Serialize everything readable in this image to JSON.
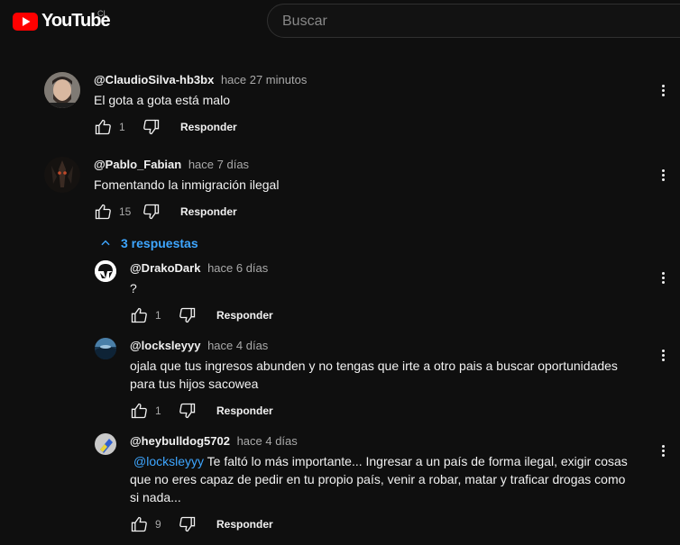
{
  "header": {
    "logo_text": "YouTube",
    "country_code": "CL",
    "search_placeholder": "Buscar"
  },
  "colors": {
    "background": "#0f0f0f",
    "text": "#f1f1f1",
    "secondary": "#aaaaaa",
    "link": "#3ea6ff",
    "brand_red": "#ff0000"
  },
  "comments": [
    {
      "author": "@ClaudioSilva-hb3bx",
      "time": "hace 27 minutos",
      "text": "El gota a gota está malo",
      "likes": "1",
      "reply_label": "Responder"
    },
    {
      "author": "@Pablo_Fabian",
      "time": "hace 7 días",
      "text": "Fomentando la inmigración ilegal",
      "likes": "15",
      "reply_label": "Responder"
    }
  ],
  "replies_toggle": {
    "label": "3 respuestas",
    "icon": "chevron-up-icon"
  },
  "replies": [
    {
      "author": "@DrakoDark",
      "time": "hace 6 días",
      "text": "?",
      "likes": "1",
      "reply_label": "Responder"
    },
    {
      "author": "@locksleyyy",
      "time": "hace 4 días",
      "text": "ojala que tus ingresos abunden y no tengas que irte a otro pais a buscar oportunidades para tus hijos sacowea",
      "likes": "1",
      "reply_label": "Responder"
    },
    {
      "author": "@heybulldog5702",
      "time": "hace 4 días",
      "mention": "@locksleyyy",
      "text": " Te faltó lo más importante... Ingresar a un país de forma ilegal, exigir cosas que no eres capaz de pedir en tu propio país, venir a robar, matar y traficar drogas como si nada...",
      "likes": "9",
      "reply_label": "Responder"
    }
  ]
}
